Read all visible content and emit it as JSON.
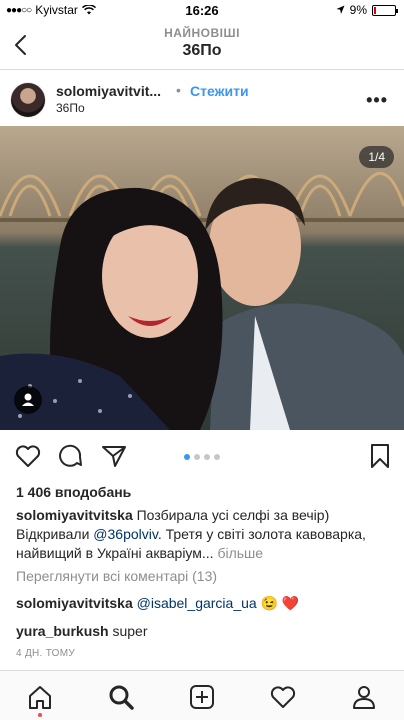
{
  "status_bar": {
    "carrier": "Kyivstar",
    "time": "16:26",
    "battery": "9%",
    "battery_level": 0.09
  },
  "header": {
    "subtitle": "НАЙНОВІШІ",
    "title": "36По"
  },
  "post": {
    "username": "solomiyavitvit...",
    "separator": "•",
    "follow_label": "Стежити",
    "location": "36По",
    "more_label": "•••",
    "photo_counter": "1/4",
    "carousel": {
      "count": 4,
      "active": 0
    },
    "likes": "1 406 вподобань",
    "caption": {
      "author": "solomiyavitvitska",
      "text_1": " Позбирала усі селфі за вечір) Відкривали ",
      "mention": "@36polviv",
      "text_2": ". Третя у світі золота кавоварка, найвищий в Україні акваріум...",
      "more": " більше"
    },
    "view_all_comments": "Переглянути всі коментарі (13)",
    "comments": [
      {
        "author": "solomiyavitvitska",
        "mention": "@isabel_garcia_ua",
        "text": " 😉 ❤️"
      },
      {
        "author": "yura_burkush",
        "text": " super"
      }
    ],
    "timestamp": "4 ДН. ТОМУ"
  },
  "icons": {
    "back": "chevron-left-icon",
    "heart": "heart-icon",
    "comment": "comment-icon",
    "share": "share-icon",
    "bookmark": "bookmark-icon",
    "home": "home-icon",
    "search": "search-icon",
    "add": "add-post-icon",
    "activity": "activity-heart-icon",
    "profile": "profile-icon"
  },
  "colors": {
    "link": "#3897f0",
    "mention": "#003569",
    "muted": "#8e8e8e",
    "notification": "#ed4956"
  }
}
